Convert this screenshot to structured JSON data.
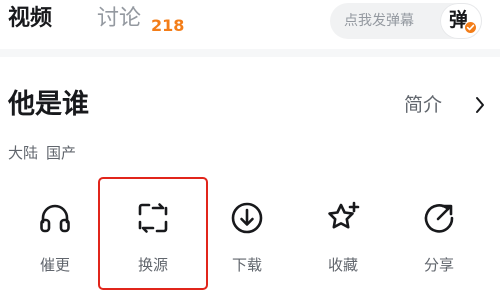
{
  "tabs": {
    "video_label": "视频",
    "discuss_label": "讨论",
    "discuss_count": "218"
  },
  "danmaku": {
    "placeholder": "点我发弹幕",
    "toggle_char": "弹"
  },
  "video": {
    "title": "他是谁",
    "intro_label": "简介",
    "region": "大陆",
    "category": "国产"
  },
  "actions": [
    {
      "label": "催更",
      "icon": "headphones-icon"
    },
    {
      "label": "换源",
      "icon": "switch-source-icon"
    },
    {
      "label": "下载",
      "icon": "download-icon"
    },
    {
      "label": "收藏",
      "icon": "star-plus-icon"
    },
    {
      "label": "分享",
      "icon": "share-icon"
    }
  ],
  "colors": {
    "accent": "#f37d18",
    "badge": "#f37d18",
    "highlight": "#e1251b",
    "icon": "#18191c",
    "muted": "#61666d"
  }
}
